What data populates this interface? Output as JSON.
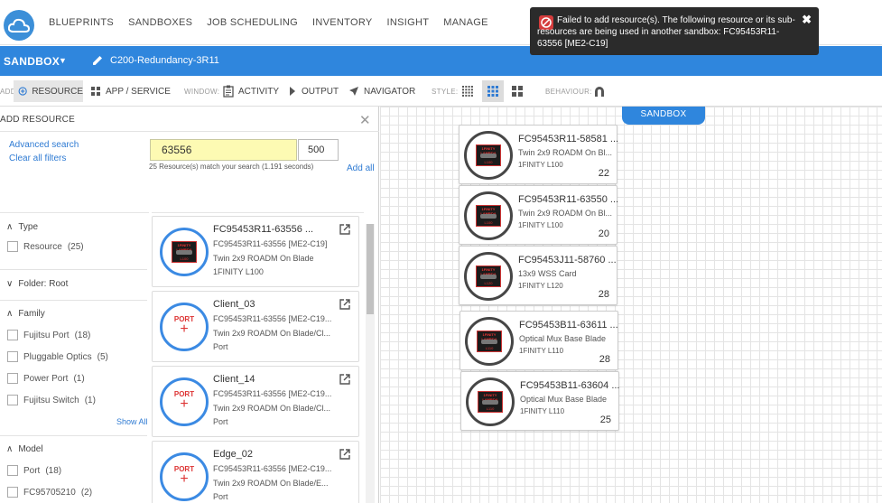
{
  "nav": {
    "items": [
      "BLUEPRINTS",
      "SANDBOXES",
      "JOB SCHEDULING",
      "INVENTORY",
      "INSIGHT",
      "MANAGE"
    ]
  },
  "sandbox_bar": {
    "label": "SANDBOX",
    "name": "C200-Redundancy-3R11"
  },
  "toolbar": {
    "add_label": "ADD:",
    "resource": "RESOURCE",
    "app_service": "APP / SERVICE",
    "window_label": "WINDOW:",
    "activity": "ACTIVITY",
    "output": "OUTPUT",
    "navigator": "NAVIGATOR",
    "style_label": "STYLE:",
    "behaviour_label": "BEHAVIOUR:"
  },
  "add_resource": {
    "title": "ADD RESOURCE",
    "advanced_search": "Advanced search",
    "clear_filters": "Clear all filters",
    "search_value": "63556",
    "count_value": "500",
    "match_text": "25 Resource(s) match your search (1.191 seconds)",
    "add_all": "Add all"
  },
  "filters": {
    "type_header": "Type",
    "type_items": [
      {
        "label": "Resource",
        "count": "(25)"
      }
    ],
    "folder": "Folder: Root",
    "family_header": "Family",
    "family_items": [
      {
        "label": "Fujitsu Port",
        "count": "(18)"
      },
      {
        "label": "Pluggable Optics",
        "count": "(5)"
      },
      {
        "label": "Power Port",
        "count": "(1)"
      },
      {
        "label": "Fujitsu Switch",
        "count": "(1)"
      }
    ],
    "show_all": "Show All",
    "model_header": "Model",
    "model_items": [
      {
        "label": "Port",
        "count": "(18)"
      },
      {
        "label": "FC95705210",
        "count": "(2)"
      }
    ]
  },
  "results": [
    {
      "title": "FC95453R11-63556 ...",
      "line2": "FC95453R11-63556 [ME2-C19]",
      "line3": "Twin 2x9 ROADM On Blade",
      "line4": "1FINITY L100",
      "icon": "chip",
      "chip_top": "1FINITY LAMBDA",
      "chip_bottom": "L100"
    },
    {
      "title": "Client_03",
      "line2": "FC95453R11-63556 [ME2-C19...",
      "line3": "Twin 2x9 ROADM On Blade/Cl...",
      "line4": "Port",
      "icon": "port",
      "port_label": "PORT"
    },
    {
      "title": "Client_14",
      "line2": "FC95453R11-63556 [ME2-C19...",
      "line3": "Twin 2x9 ROADM On Blade/Cl...",
      "line4": "Port",
      "icon": "port",
      "port_label": "PORT"
    },
    {
      "title": "Edge_02",
      "line2": "FC95453R11-63556 [ME2-C19...",
      "line3": "Twin 2x9 ROADM On Blade/E...",
      "line4": "Port",
      "icon": "port",
      "port_label": "PORT"
    }
  ],
  "canvas": {
    "tag": "SANDBOX",
    "cards": [
      {
        "title": "FC95453R11-58581 ...",
        "desc": "Twin 2x9 ROADM On Bl...",
        "model": "1FINITY L100",
        "count": "22",
        "chip_top": "1FINITY LAMBDA",
        "chip_bottom": "L100"
      },
      {
        "title": "FC95453R11-63550 ...",
        "desc": "Twin 2x9 ROADM On Bl...",
        "model": "1FINITY L100",
        "count": "20",
        "chip_top": "1FINITY LAMBDA",
        "chip_bottom": "L100"
      },
      {
        "title": "FC95453J11-58760 ...",
        "desc": "13x9 WSS Card",
        "model": "1FINITY L120",
        "count": "28",
        "chip_top": "1FINITY LAMBDA",
        "chip_bottom": "L120"
      },
      {
        "title": "FC95453B11-63611 ...",
        "desc": "Optical Mux Base Blade",
        "model": "1FINITY L110",
        "count": "28",
        "chip_top": "1FINITY LAMBDA",
        "chip_bottom": "L110"
      },
      {
        "title": "FC95453B11-63604 ...",
        "desc": "Optical Mux Base Blade",
        "model": "1FINITY L110",
        "count": "25",
        "chip_top": "1FINITY LAMBDA",
        "chip_bottom": "L110"
      }
    ]
  },
  "toast": {
    "message": "Failed to add resource(s). The following resource or its sub-resources are being used in another sandbox: FC95453R11-63556 [ME2-C19]",
    "close": "✖"
  },
  "colors": {
    "brand": "#2f86dd",
    "error": "#d53c3c",
    "highlight": "#fdfab3"
  }
}
